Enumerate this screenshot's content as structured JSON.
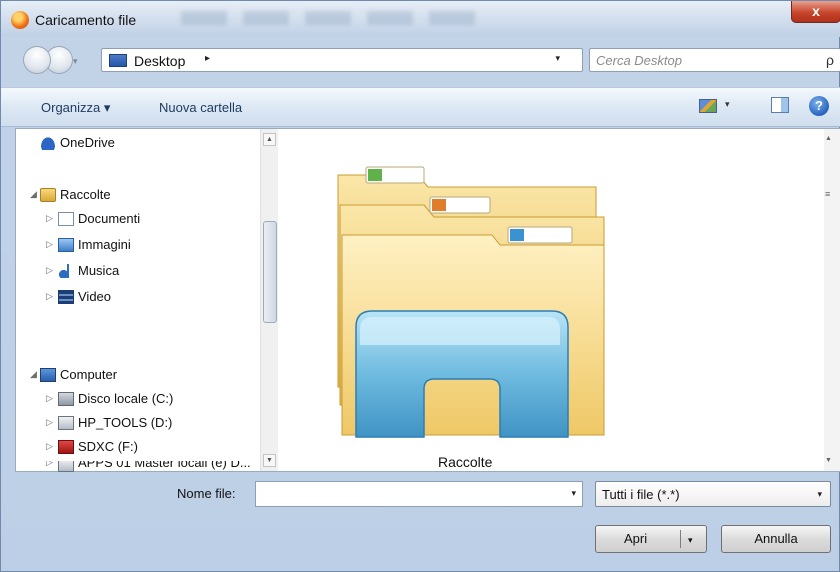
{
  "window": {
    "title": "Caricamento file",
    "close_glyph": "x"
  },
  "nav": {
    "location": "Desktop",
    "location_arrow": "▸",
    "refresh_glyph": "⁴↻",
    "search_placeholder": "Cerca Desktop",
    "search_icon_glyph": "ρ"
  },
  "toolbar": {
    "organizza": "Organizza ▾",
    "nuova_cartella": "Nuova cartella",
    "view_dropdown": "▾",
    "help_glyph": "?"
  },
  "tree": {
    "items": [
      {
        "label": "OneDrive",
        "icon": "onedrive-icon"
      },
      {
        "label": "Raccolte",
        "icon": "libraries-icon"
      },
      {
        "label": "Documenti",
        "icon": "documents-icon"
      },
      {
        "label": "Immagini",
        "icon": "pictures-icon"
      },
      {
        "label": "Musica",
        "icon": "music-icon"
      },
      {
        "label": "Video",
        "icon": "video-icon"
      },
      {
        "label": "Computer",
        "icon": "computer-icon"
      },
      {
        "label": "Disco locale (C:)",
        "icon": "local-disk-icon"
      },
      {
        "label": "HP_TOOLS (D:)",
        "icon": "drive-icon"
      },
      {
        "label": "SDXC (F:)",
        "icon": "sd-card-icon"
      },
      {
        "label": "APPS 01 Master locali (e) D...",
        "icon": "drive-icon"
      }
    ]
  },
  "main": {
    "item_label": "Raccolte",
    "item_icon": "libraries-folder-icon"
  },
  "bottom": {
    "filename_label": "Nome file:",
    "filename_value": "",
    "filter_value": "Tutti i file (*.*)",
    "open_button": "Apri",
    "cancel_button": "Annulla"
  },
  "colors": {
    "window_frame": "#c2d3e8",
    "close_button": "#c8452b",
    "folder_yellow": "#f4d27a",
    "libraries_blue": "#6fbbe0"
  }
}
